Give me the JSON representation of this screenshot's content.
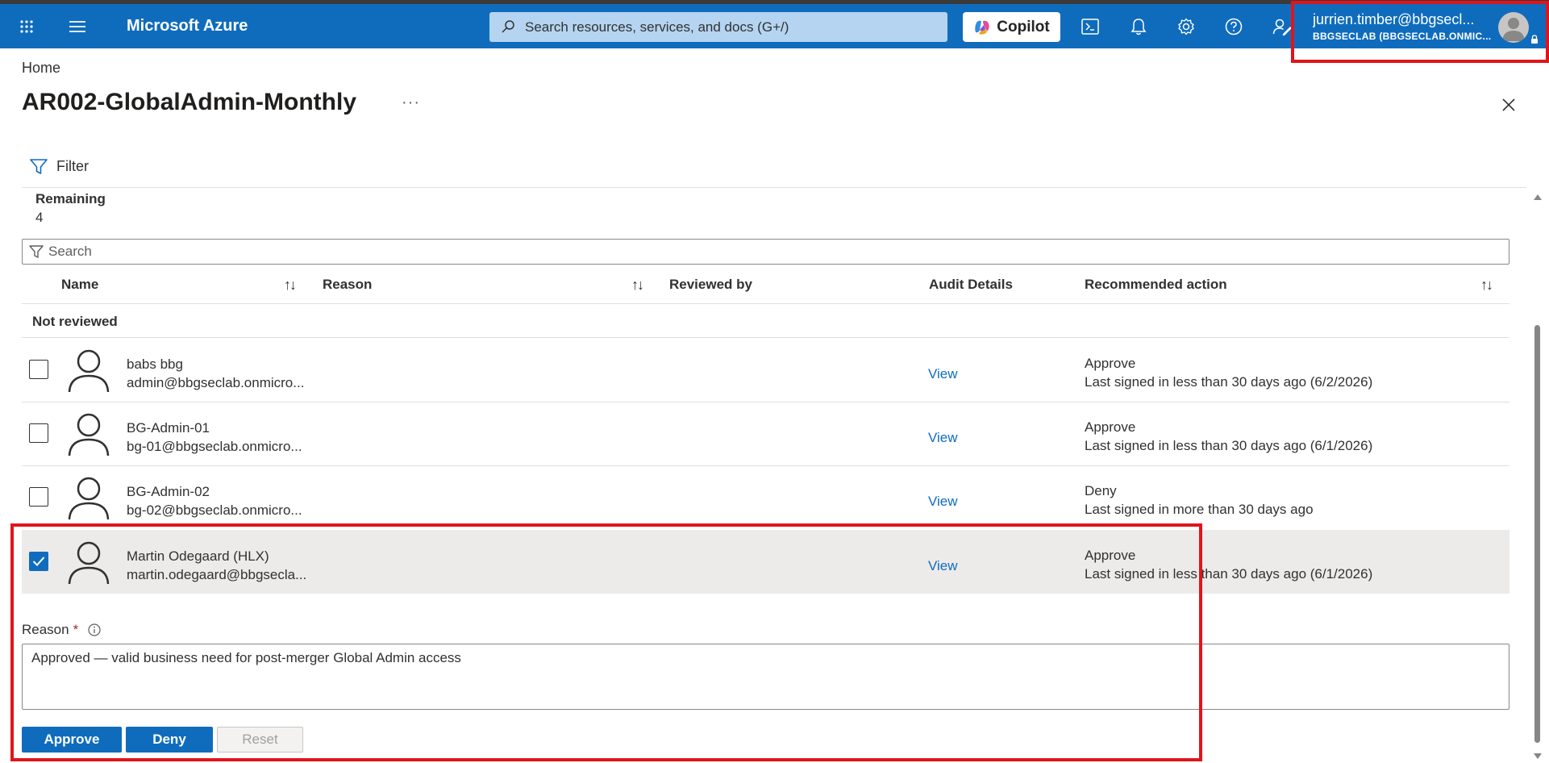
{
  "header": {
    "brand": "Microsoft Azure",
    "search_placeholder": "Search resources, services, and docs (G+/)",
    "copilot_label": "Copilot",
    "account_name": "jurrien.timber@bbgsecl...",
    "account_tenant": "BBGSECLAB (BBGSECLAB.ONMIC...",
    "accent_color": "#0f6cbd"
  },
  "breadcrumb": "Home",
  "page": {
    "title": "AR002-GlobalAdmin-Monthly",
    "more_label": "···",
    "filter_label": "Filter",
    "remaining_label": "Remaining",
    "remaining_value": "4",
    "table_search_placeholder": "Search"
  },
  "table": {
    "columns": [
      "Name",
      "Reason",
      "Reviewed by",
      "Audit Details",
      "Recommended action"
    ],
    "group_label": "Not reviewed",
    "rows": [
      {
        "name": "babs bbg",
        "email": "admin@bbgseclab.onmicro...",
        "audit": "View",
        "action": "Approve",
        "detail": "Last signed in less than 30 days ago (6/2/2026)",
        "checked": false
      },
      {
        "name": "BG-Admin-01",
        "email": "bg-01@bbgseclab.onmicro...",
        "audit": "View",
        "action": "Approve",
        "detail": "Last signed in less than 30 days ago (6/1/2026)",
        "checked": false
      },
      {
        "name": "BG-Admin-02",
        "email": "bg-02@bbgseclab.onmicro...",
        "audit": "View",
        "action": "Deny",
        "detail": "Last signed in more than 30 days ago",
        "checked": false
      },
      {
        "name": "Martin Odegaard (HLX)",
        "email": "martin.odegaard@bbgsecla...",
        "audit": "View",
        "action": "Approve",
        "detail": "Last signed in less than 30 days ago (6/1/2026)",
        "checked": true
      }
    ]
  },
  "review": {
    "reason_label": "Reason",
    "required_mark": "*",
    "reason_value": "Approved — valid business need for post-merger Global Admin access",
    "approve_label": "Approve",
    "deny_label": "Deny",
    "reset_label": "Reset"
  },
  "highlight_color": "#e0151b"
}
